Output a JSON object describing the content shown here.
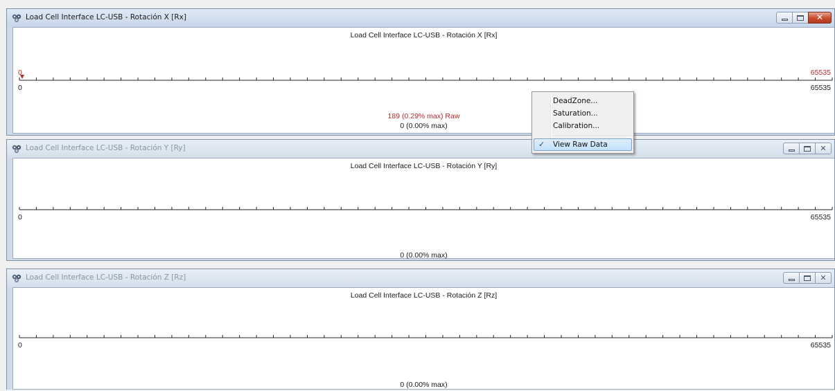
{
  "windows": [
    {
      "title": "Load Cell Interface LC-USB - Rotación X [Rx]",
      "inner_title": "Load Cell Interface LC-USB - Rotación X [Rx]",
      "scale_min": "0",
      "scale_max": "65535",
      "marker_value": "0",
      "marker_max": "65535",
      "raw_readout": "189 (0.29% max)  Raw",
      "readout": "0 (0.00% max)",
      "active": true
    },
    {
      "title": "Load Cell Interface LC-USB - Rotación Y [Ry]",
      "inner_title": "Load Cell Interface LC-USB - Rotación Y [Ry]",
      "scale_min": "0",
      "scale_max": "65535",
      "readout": "0 (0.00% max)",
      "active": false
    },
    {
      "title": "Load Cell Interface LC-USB - Rotación Z [Rz]",
      "inner_title": "Load Cell Interface LC-USB - Rotación Z [Rz]",
      "scale_min": "0",
      "scale_max": "65535",
      "readout": "0 (0.00% max)",
      "active": false
    }
  ],
  "context_menu": {
    "items": [
      {
        "label": "DeadZone..."
      },
      {
        "label": "Saturation..."
      },
      {
        "label": "Calibration..."
      },
      {
        "label": "View Raw Data",
        "checked": true
      }
    ]
  },
  "icons": {
    "app": "load-cell-app-icon",
    "minimize": "minimize-icon",
    "maximize": "maximize-icon",
    "close": "close-icon",
    "check": "check-icon",
    "marker": "marker-arrow-icon"
  },
  "colors": {
    "raw_accent": "#b32b2b",
    "close_active": "#c74a2c",
    "menu_highlight": "#c3e0fa"
  }
}
